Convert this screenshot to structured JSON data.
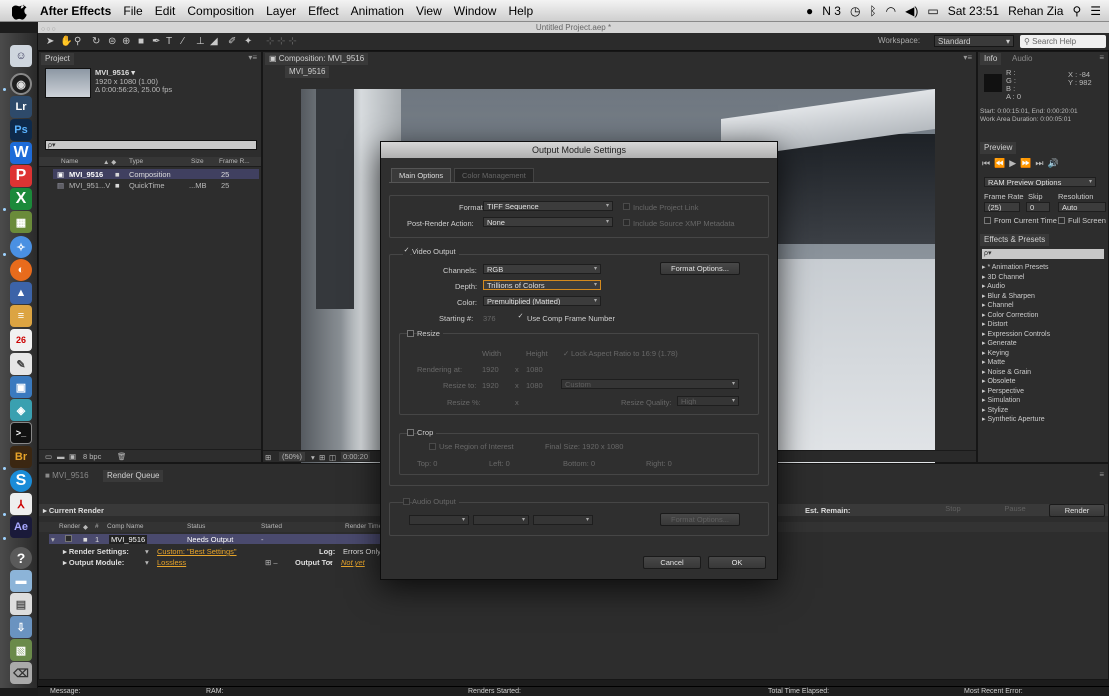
{
  "menubar": {
    "app": "After Effects",
    "items": [
      "File",
      "Edit",
      "Composition",
      "Layer",
      "Effect",
      "Animation",
      "View",
      "Window",
      "Help"
    ],
    "badge": "N 3",
    "clock": "Sat 23:51",
    "user": "Rehan Zia"
  },
  "window": {
    "title": "Untitled Project.aep *"
  },
  "toolbar": {
    "workspace_label": "Workspace:",
    "workspace_value": "Standard",
    "search_placeholder": "Search Help"
  },
  "dock": {
    "labels": [
      "Lr",
      "Ps",
      "Br",
      "Ae"
    ]
  },
  "project": {
    "tab": "Project",
    "item_name": "MVI_9516 ▾",
    "item_res": "1920 x 1080 (1.00)",
    "item_dur": "Δ 0:00:56:23, 25.00 fps",
    "search": "ρ▾",
    "columns": [
      "Name",
      "Type",
      "Size",
      "Frame R..."
    ],
    "rows": [
      {
        "name": "MVI_9516",
        "type": "Composition",
        "size": "",
        "fr": "25"
      },
      {
        "name": "MVI_951...V",
        "type": "QuickTime",
        "size": "...MB",
        "fr": "25"
      }
    ],
    "bpc": "8 bpc"
  },
  "comp": {
    "tab": "Composition: MVI_9516",
    "subtab": "MVI_9516",
    "zoom": "(50%)",
    "time": "0:00:20"
  },
  "info": {
    "tab": "Info",
    "tab2": "Audio",
    "r": "R :",
    "g": "G :",
    "b": "B :",
    "a": "A : 0",
    "x": "X : -84",
    "y": "Y : 982",
    "start": "Start: 0:00:15:01, End: 0:00:20:01",
    "work": "Work Area Duration: 0:00:05:01"
  },
  "preview": {
    "tab": "Preview",
    "ram": "RAM Preview Options",
    "fr_label": "Frame Rate",
    "skip_label": "Skip",
    "res_label": "Resolution",
    "fr_value": "(25)",
    "skip_value": "0",
    "res_value": "Auto",
    "from_current": "From Current Time",
    "full_screen": "Full Screen"
  },
  "effects": {
    "tab": "Effects & Presets",
    "search": "ρ▾",
    "items": [
      "* Animation Presets",
      "3D Channel",
      "Audio",
      "Blur & Sharpen",
      "Channel",
      "Color Correction",
      "Distort",
      "Expression Controls",
      "Generate",
      "Keying",
      "Matte",
      "Noise & Grain",
      "Obsolete",
      "Perspective",
      "Simulation",
      "Stylize",
      "Synthetic Aperture"
    ]
  },
  "queue": {
    "tab1": "MVI_9516",
    "tab2": "Render Queue",
    "current": "Current Render",
    "est": "Est. Remain:",
    "stop": "Stop",
    "pause": "Pause",
    "render": "Render",
    "cols": [
      "Render",
      "#",
      "Comp Name",
      "Status",
      "Started",
      "Render Time"
    ],
    "item_num": "1",
    "item_name": "MVI_9516",
    "item_status": "Needs Output",
    "item_started": "-",
    "rs_label": "Render Settings:",
    "rs_value": "Custom: \"Best Settings\"",
    "log_label": "Log:",
    "log_value": "Errors Only",
    "om_label": "Output Module:",
    "om_value": "Lossless",
    "ot_label": "Output To:",
    "ot_value": "Not yet"
  },
  "status": {
    "message": "Message:",
    "ram": "RAM:",
    "renders": "Renders Started:",
    "elapsed": "Total Time Elapsed:",
    "error": "Most Recent Error:"
  },
  "dialog": {
    "title": "Output Module Settings",
    "tab_main": "Main Options",
    "tab_color": "Color Management",
    "format_label": "Format:",
    "format_value": "TIFF Sequence",
    "include_link": "Include Project Link",
    "post_label": "Post-Render Action:",
    "post_value": "None",
    "include_xmp": "Include Source XMP Metadata",
    "video_output": "Video Output",
    "channels_label": "Channels:",
    "channels_value": "RGB",
    "format_options": "Format Options...",
    "depth_label": "Depth:",
    "depth_value": "Trillions of Colors",
    "color_label": "Color:",
    "color_value": "Premultiplied (Matted)",
    "starting_label": "Starting #:",
    "starting_value": "376",
    "use_comp": "Use Comp Frame Number",
    "resize": "Resize",
    "width": "Width",
    "height": "Height",
    "lock": "Lock Aspect Ratio to 16:9 (1.78)",
    "rendering_at": "Rendering at:",
    "rendering_w": "1920",
    "x1": "x",
    "rendering_h": "1080",
    "resize_to": "Resize to:",
    "resize_w": "1920",
    "x2": "x",
    "resize_h": "1080",
    "custom": "Custom",
    "resize_pct": "Resize %:",
    "x3": "x",
    "quality_label": "Resize Quality:",
    "quality_value": "High",
    "crop": "Crop",
    "use_roi": "Use Region of Interest",
    "final_size": "Final Size: 1920 x 1080",
    "top": "Top: 0",
    "left": "Left: 0",
    "bottom": "Bottom: 0",
    "right": "Right: 0",
    "audio_output": "Audio Output",
    "audio_format_options": "Format Options...",
    "cancel": "Cancel",
    "ok": "OK"
  }
}
